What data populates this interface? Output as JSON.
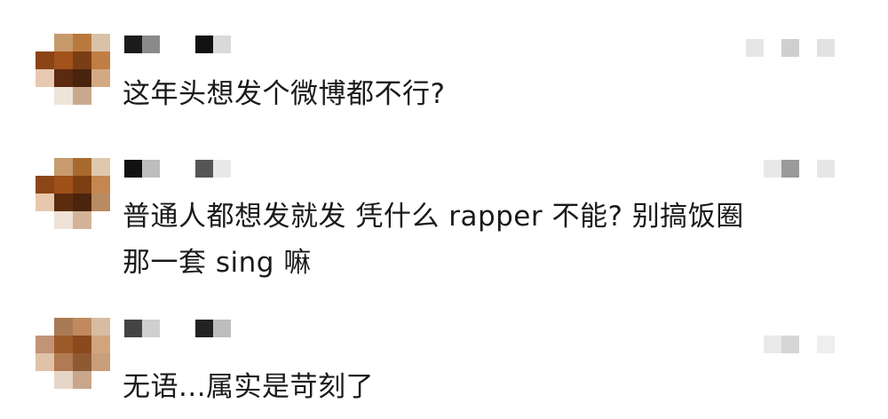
{
  "comments": [
    {
      "text_lines": [
        "这年头想发个微博都不行?"
      ],
      "avatar_colors": [
        [
          "#ffffff",
          "#c79a6c",
          "#b9793e",
          "#d9c3a6"
        ],
        [
          "#8a4416",
          "#a2521a",
          "#7b3e14",
          "#c07d44"
        ],
        [
          "#e7c8b0",
          "#5b2a10",
          "#4a230c",
          "#d3a983"
        ],
        [
          "#ffffff",
          "#efe4da",
          "#c9a98e",
          "#ffffff"
        ]
      ],
      "name_colors": [
        "#1c1c1c",
        "#8a8a8a",
        "gap",
        "#111111",
        "#d9d9d9"
      ],
      "meta_colors": [
        "#e6e6e6",
        "#ffffff",
        "#cfcfcf",
        "#ffffff",
        "#e2e2e2"
      ]
    },
    {
      "text_lines": [
        "普通人都想发就发 凭什么 rapper 不能? 别搞饭圈",
        "那一套 sing 嘛"
      ],
      "avatar_colors": [
        [
          "#ffffff",
          "#c89b6e",
          "#a8692f",
          "#e0c8ae"
        ],
        [
          "#8b4618",
          "#9e5018",
          "#7c3f12",
          "#c58650"
        ],
        [
          "#e8c8ac",
          "#5c2c10",
          "#4b240d",
          "#b98b63"
        ],
        [
          "#ffffff",
          "#efe2d6",
          "#d2b398",
          "#ffffff"
        ]
      ],
      "name_colors": [
        "#111111",
        "#bdbdbd",
        "gap",
        "#555555",
        "#e8e8e8"
      ],
      "meta_colors": [
        "#ffffff",
        "#e8e8e8",
        "#9a9a9a",
        "#ffffff",
        "#e6e6e6"
      ]
    },
    {
      "text_lines": [
        "无语...属实是苛刻了"
      ],
      "avatar_colors": [
        [
          "#ffffff",
          "#a87a55",
          "#c08a5c",
          "#d8bca2"
        ],
        [
          "#c29376",
          "#9c5a2a",
          "#8a4a1e",
          "#d2a47e"
        ],
        [
          "#e0c2a8",
          "#b27a52",
          "#8e5a34",
          "#c99e7a"
        ],
        [
          "#ffffff",
          "#e6d6c8",
          "#c9a68a",
          "#ffffff"
        ]
      ],
      "name_colors": [
        "#444444",
        "#cfcfcf",
        "gap",
        "#222222",
        "#bdbdbd"
      ],
      "meta_colors": [
        "#ffffff",
        "#e9e9e9",
        "#d6d6d6",
        "#ffffff",
        "#eeeeee"
      ]
    }
  ]
}
